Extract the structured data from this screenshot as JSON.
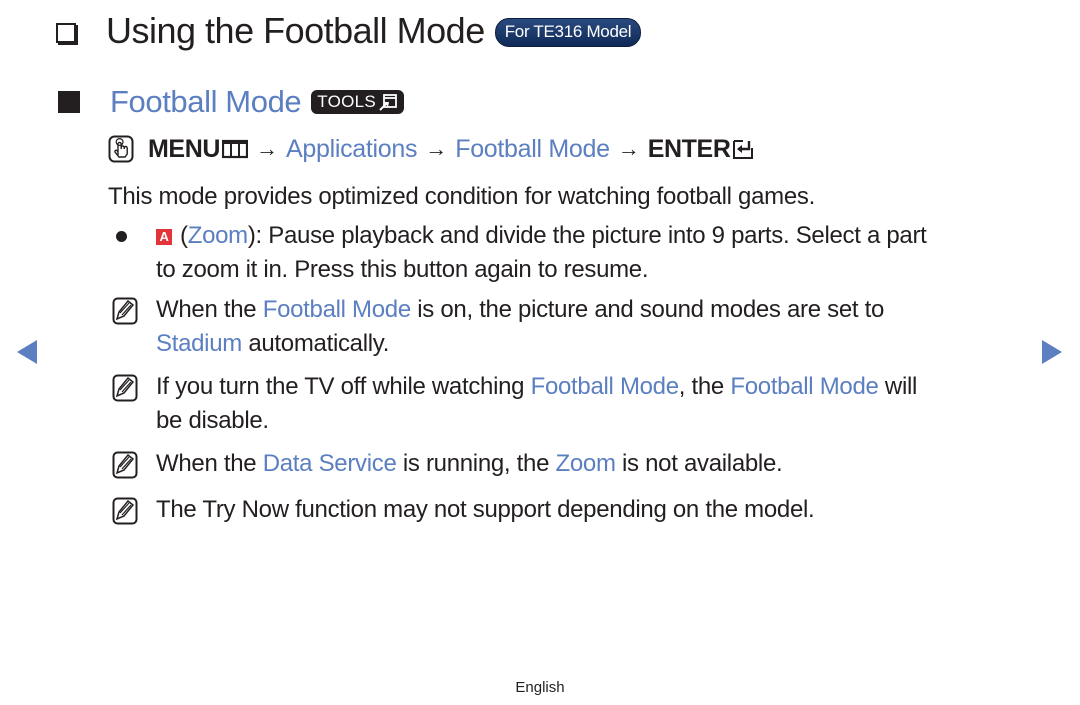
{
  "header": {
    "title": "Using the Football Mode",
    "model_badge": "For TE316 Model"
  },
  "section": {
    "title": "Football Mode",
    "tools_badge": "TOOLS"
  },
  "menu_path": {
    "menu_label": "MENU",
    "arrow": "→",
    "step1": "Applications",
    "step2": "Football Mode",
    "enter_label": "ENTER"
  },
  "intro": "This mode provides optimized condition for watching football games.",
  "bullet": {
    "key_letter": "A",
    "open_paren": "(",
    "highlight": "Zoom",
    "text_line1": "): Pause playback and divide the picture into 9 parts. Select a part",
    "text_line2": "to zoom it in. Press this button again to resume."
  },
  "notes": [
    {
      "pre": "When the ",
      "hl1": "Football Mode",
      "mid": " is on, the picture and sound modes are set to",
      "hl2": "Stadium",
      "post": " automatically."
    },
    {
      "pre": "If you turn the TV off while watching ",
      "hl1": "Football Mode",
      "mid": ", the ",
      "hl2": "Football Mode",
      "post": " will",
      "line2": "be disable."
    },
    {
      "pre": "When the ",
      "hl1": "Data Service",
      "mid": " is running, the ",
      "hl2": "Zoom",
      "post": " is not available."
    },
    {
      "text": "The Try Now function may not support depending on the model."
    }
  ],
  "navigation": {
    "prev_icon": "triangle-left",
    "next_icon": "triangle-right"
  },
  "footer": {
    "language": "English"
  },
  "colors": {
    "accent": "#5b7fc0",
    "text": "#231f20",
    "badge": "#1a3a6c",
    "key_red": "#e2343a"
  }
}
